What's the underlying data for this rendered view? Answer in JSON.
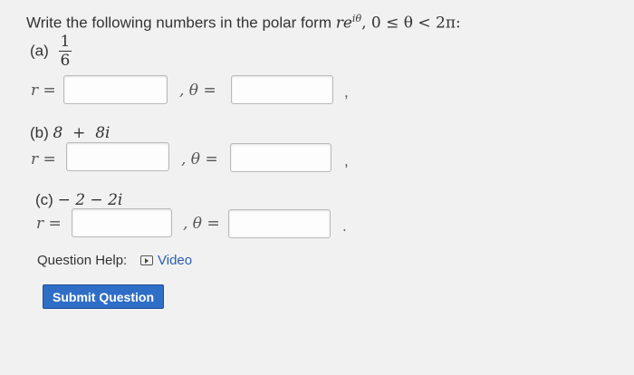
{
  "prompt": {
    "text_before": "Write the following numbers in the polar form ",
    "re": "re",
    "exp": "iθ",
    "condition": ", 0 ≤ θ < 2π:"
  },
  "parts": [
    {
      "label": "(a)",
      "fraction": {
        "numerator": "1",
        "denominator": "6"
      },
      "r_label": "r =",
      "theta_label": ", θ =",
      "trail": ","
    },
    {
      "label": "(b)",
      "expr": "8  +  8i",
      "r_label": "r =",
      "theta_label": ", θ =",
      "trail": ","
    },
    {
      "label": "(c)",
      "expr": "− 2 − 2i",
      "r_label": "r =",
      "theta_label": ", θ =",
      "trail": "."
    }
  ],
  "help": {
    "label": "Question Help:",
    "video_label": "Video"
  },
  "submit": {
    "label": "Submit Question"
  },
  "colors": {
    "accent": "#2f6ec7",
    "link": "#2a5db0",
    "background": "#f1f1f1"
  }
}
